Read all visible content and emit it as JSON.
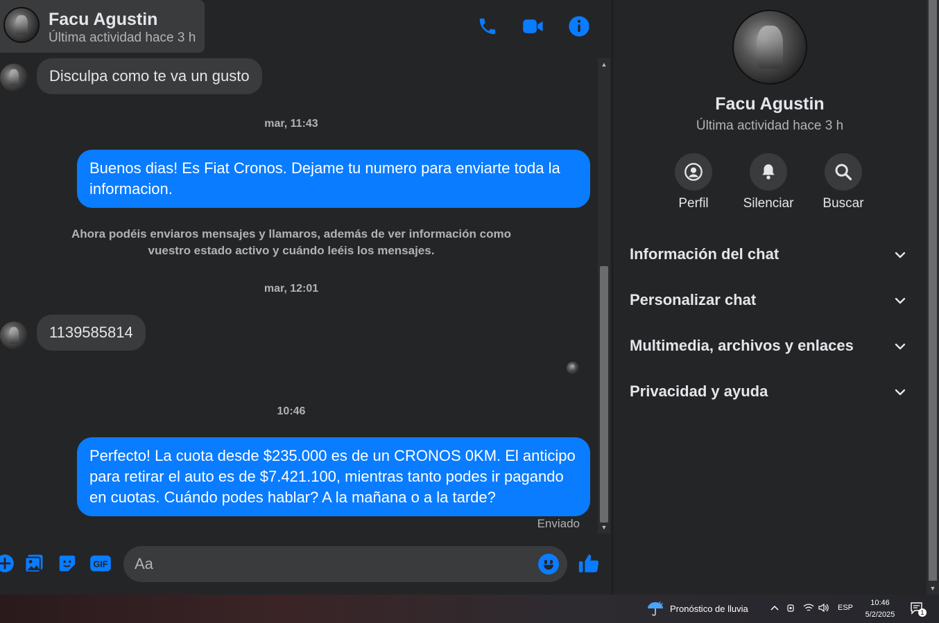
{
  "header": {
    "name": "Facu Agustin",
    "status": "Última actividad hace 3 h"
  },
  "messages": {
    "m1": "Disculpa como te va un gusto",
    "t1": "mar, 11:43",
    "m2": "Buenos dias! Es Fiat Cronos. Dejame tu numero para enviarte toda la informacion.",
    "note": "Ahora podéis enviaros mensajes y llamaros, además de ver información como vuestro estado activo y cuándo leéis los mensajes.",
    "t2": "mar, 12:01",
    "m3": "1139585814",
    "t3": "10:46",
    "m4": "Perfecto! La cuota desde $235.000 es de un CRONOS 0KM. El anticipo para retirar el auto es de $7.421.100, mientras tanto podes ir pagando en cuotas. Cuándo podes hablar? A la mañana o a la tarde?",
    "sent": "Enviado"
  },
  "composer": {
    "placeholder": "Aa"
  },
  "info": {
    "name": "Facu Agustin",
    "status": "Última actividad hace 3 h",
    "actions": [
      {
        "label": "Perfil",
        "icon": "profile-icon"
      },
      {
        "label": "Silenciar",
        "icon": "bell-icon"
      },
      {
        "label": "Buscar",
        "icon": "search-icon"
      }
    ],
    "sections": [
      {
        "label": "Información del chat"
      },
      {
        "label": "Personalizar chat"
      },
      {
        "label": "Multimedia, archivos y enlaces"
      },
      {
        "label": "Privacidad y ayuda"
      }
    ]
  },
  "taskbar": {
    "weather": "Pronóstico de lluvia",
    "lang": "ESP",
    "time": "10:46",
    "date": "5/2/2025",
    "notif_count": "1"
  },
  "colors": {
    "accent": "#0a7cff",
    "background": "#242526",
    "bubble_in": "#3a3b3c"
  }
}
